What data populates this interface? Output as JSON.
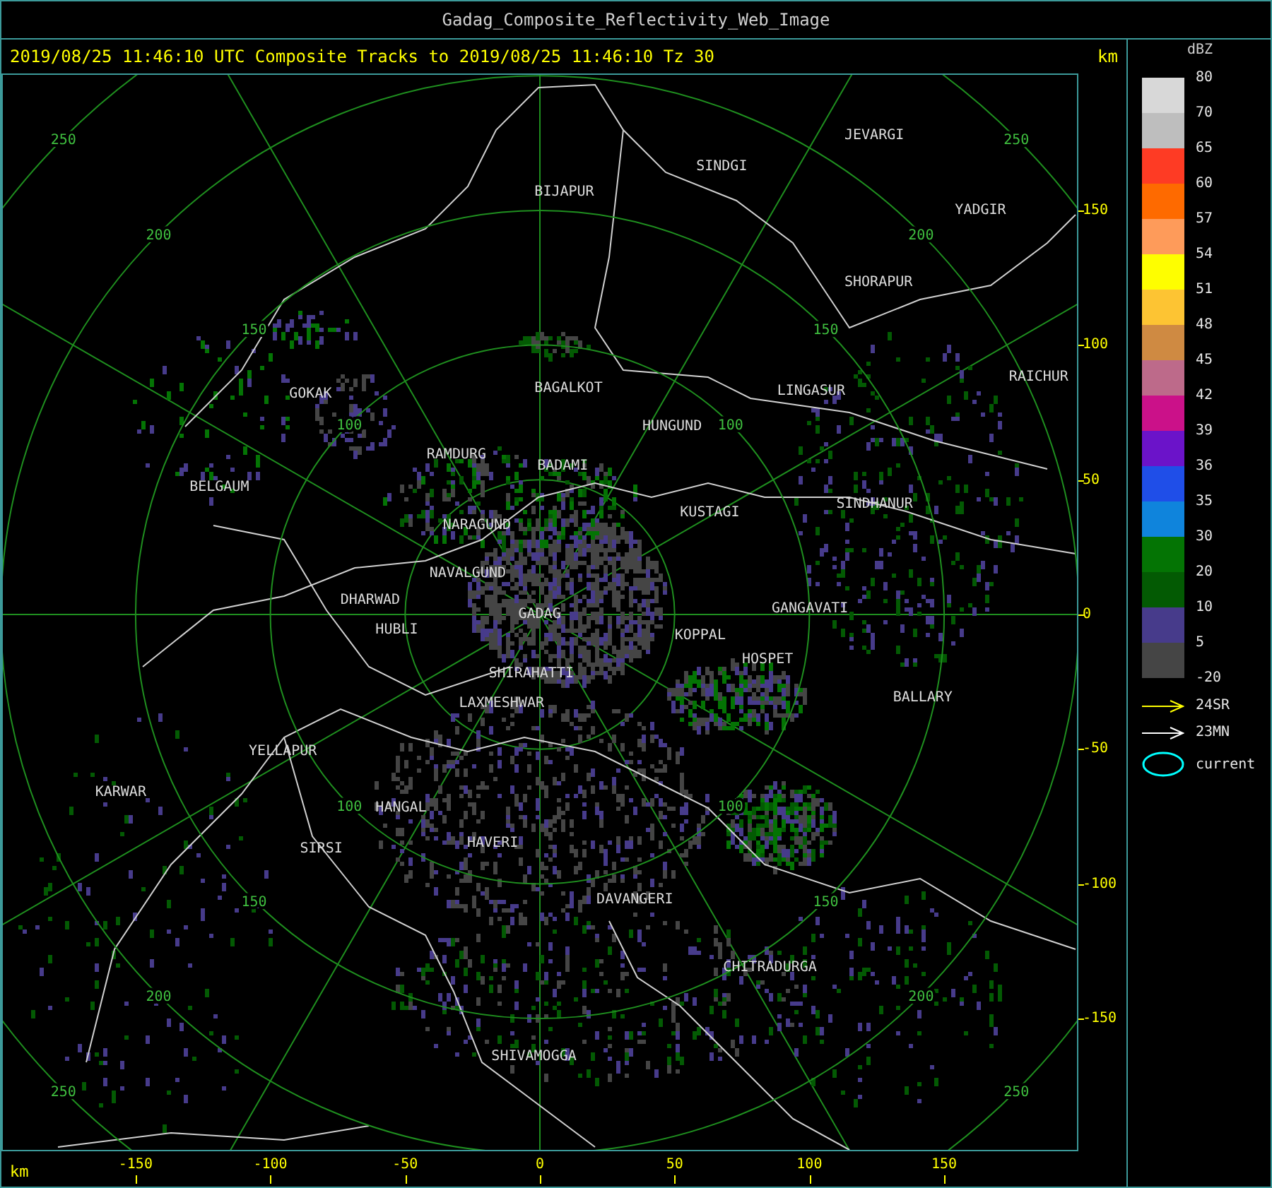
{
  "window": {
    "title": "Gadag_Composite_Reflectivity_Web_Image"
  },
  "header": {
    "text": "2019/08/25 11:46:10 UTC Composite Tracks to 2019/08/25 11:46:10 Tz 30",
    "unit": "km"
  },
  "map": {
    "places": [
      "JEVARGI",
      "SINDGI",
      "BIJAPUR",
      "YADGIR",
      "SHORAPUR",
      "GOKAK",
      "BAGALKOT",
      "LINGASUR",
      "RAICHUR",
      "HUNGUND",
      "RAMDURG",
      "BADAMI",
      "BELGAUM",
      "NARAGUND",
      "KUSTAGI",
      "SINDHANUR",
      "NAVALGUND",
      "DHARWAD",
      "HUBLI",
      "GADAG",
      "KOPPAL",
      "GANGAVATI",
      "SHIRAHATTI",
      "HOSPET",
      "LAXMESHWAR",
      "BALLARY",
      "YELLAPUR",
      "KARWAR",
      "HANGAL",
      "SIRSI",
      "HAVERI",
      "DAVANGERI",
      "CHITRADURGA",
      "SHIVAMOGGA"
    ],
    "range_rings": [
      {
        "labels": [
          "100",
          "100",
          "100",
          "100"
        ]
      },
      {
        "labels": [
          "150",
          "150",
          "150",
          "150"
        ]
      },
      {
        "labels": [
          "200",
          "200",
          "200",
          "200"
        ]
      },
      {
        "labels": [
          "250",
          "250",
          "250",
          "250"
        ]
      }
    ],
    "y_ticks": [
      "150",
      "100",
      "50",
      "0",
      "-50",
      "-100",
      "-150"
    ],
    "x_ticks": [
      "-150",
      "-100",
      "-50",
      "0",
      "50",
      "100",
      "150"
    ],
    "x_unit": "km"
  },
  "legend": {
    "title": "dBZ",
    "levels": [
      {
        "label": "80",
        "color": "#d8d8d8"
      },
      {
        "label": "70",
        "color": "#bebebe"
      },
      {
        "label": "65",
        "color": "#fe3b24"
      },
      {
        "label": "60",
        "color": "#fe6a00"
      },
      {
        "label": "57",
        "color": "#fe9b5a"
      },
      {
        "label": "54",
        "color": "#fefe00"
      },
      {
        "label": "51",
        "color": "#fdc433"
      },
      {
        "label": "48",
        "color": "#cf8a42"
      },
      {
        "label": "45",
        "color": "#bd6a8a"
      },
      {
        "label": "42",
        "color": "#cb1189"
      },
      {
        "label": "39",
        "color": "#6b13c9"
      },
      {
        "label": "36",
        "color": "#1f4ee8"
      },
      {
        "label": "35",
        "color": "#0f84dc"
      },
      {
        "label": "30",
        "color": "#047404"
      },
      {
        "label": "20",
        "color": "#035a03"
      },
      {
        "label": "10",
        "color": "#473b8b"
      },
      {
        "label": "5",
        "color": "#454545"
      }
    ],
    "bottom_label": "-20",
    "tracks": [
      {
        "kind": "arrow",
        "color": "#ffff00",
        "label": "24SR"
      },
      {
        "kind": "arrow",
        "color": "#ffffff",
        "label": "23MN"
      },
      {
        "kind": "ellipse",
        "color": "#00ffff",
        "label": "current"
      }
    ]
  }
}
